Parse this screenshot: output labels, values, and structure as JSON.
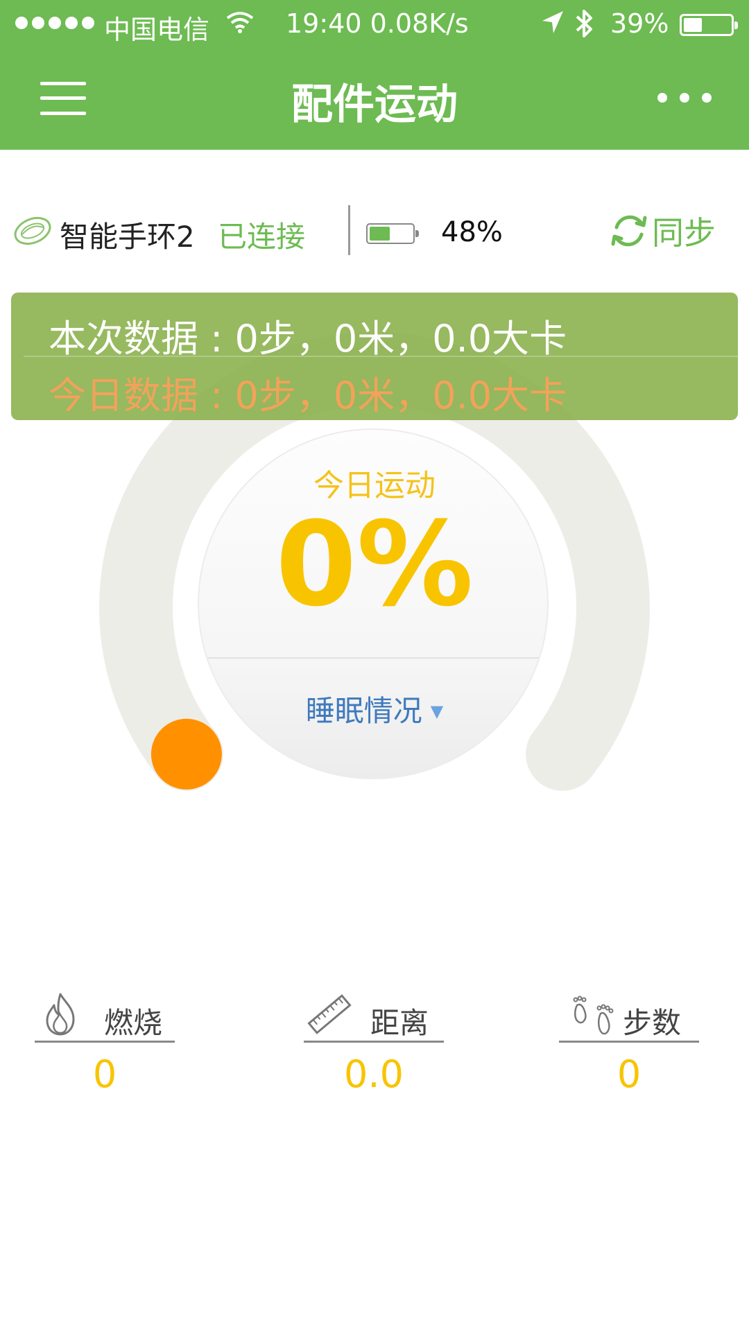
{
  "status_bar": {
    "carrier": "中国电信",
    "time_speed": "19:40 0.08K/s",
    "battery_pct": "39%"
  },
  "nav": {
    "title": "配件运动"
  },
  "device": {
    "name": "智能手环2",
    "connection_status": "已连接",
    "battery_pct": "48%",
    "battery_level": 0.48,
    "sync_label": "同步"
  },
  "data_panel": {
    "session": "本次数据 : 0步，0米，0.0大卡",
    "today": "今日数据 : 0步，0米，0.0大卡"
  },
  "progress": {
    "label": "今日运动",
    "percent_text": "0%",
    "value": 0,
    "sleep_label": "睡眠情况"
  },
  "stats": [
    {
      "label": "燃烧",
      "value": "0",
      "icon": "flame-icon"
    },
    {
      "label": "距离",
      "value": "0.0",
      "icon": "ruler-icon"
    },
    {
      "label": "步数",
      "value": "0",
      "icon": "footprints-icon"
    }
  ],
  "colors": {
    "brand_green": "#6dbb52",
    "accent_yellow": "#f8c400",
    "indicator_orange": "#ff9100",
    "sleep_blue": "#3f79bd"
  }
}
